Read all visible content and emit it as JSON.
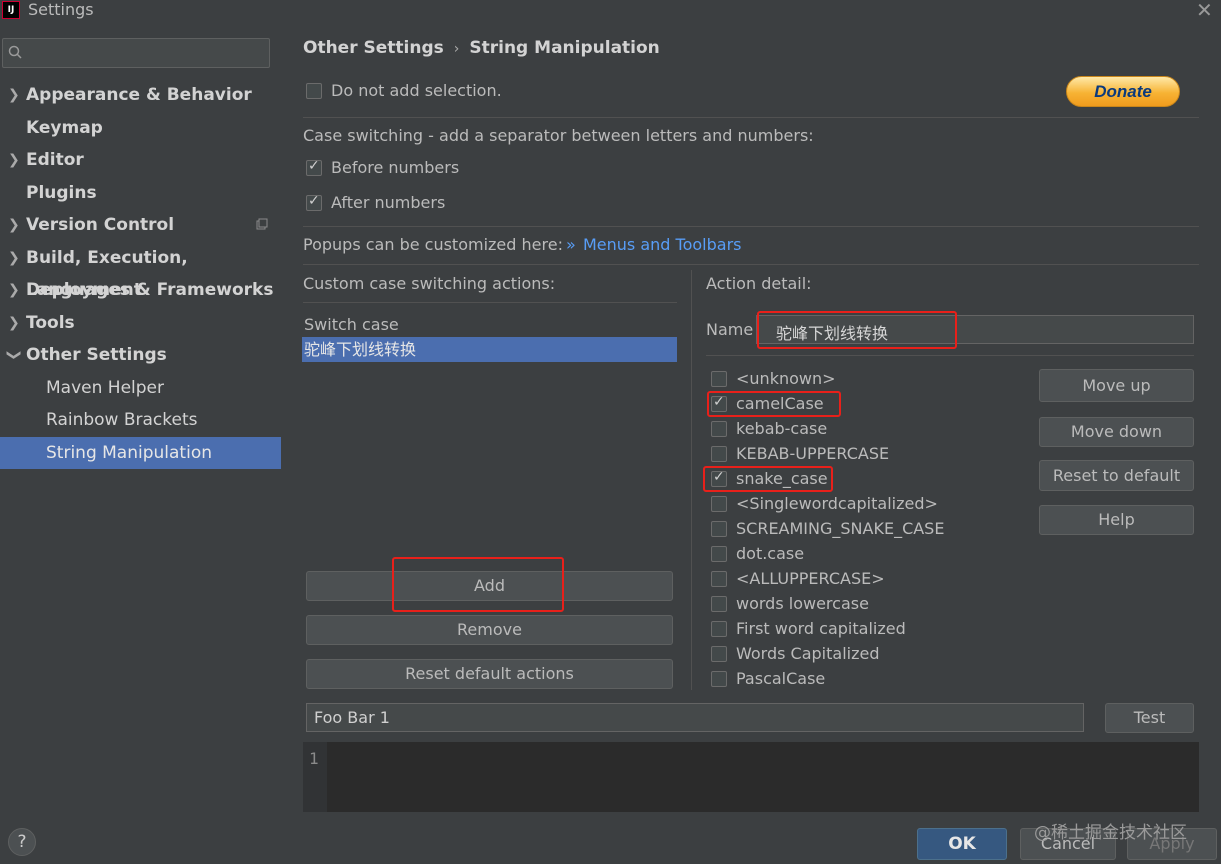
{
  "window": {
    "title": "Settings",
    "app_icon": "IJ"
  },
  "sidebar": {
    "search_placeholder": "",
    "items": [
      {
        "label": "Appearance & Behavior",
        "expandable": true
      },
      {
        "label": "Keymap",
        "expandable": false
      },
      {
        "label": "Editor",
        "expandable": true
      },
      {
        "label": "Plugins",
        "expandable": false
      },
      {
        "label": "Version Control",
        "expandable": true
      },
      {
        "label": "Build, Execution, Deployment",
        "expandable": true
      },
      {
        "label": "Languages & Frameworks",
        "expandable": true
      },
      {
        "label": "Tools",
        "expandable": true
      },
      {
        "label": "Other Settings",
        "expandable": true,
        "expanded": true
      },
      {
        "label": "Maven Helper"
      },
      {
        "label": "Rainbow Brackets"
      },
      {
        "label": "String Manipulation",
        "selected": true
      }
    ]
  },
  "breadcrumb": {
    "parent": "Other Settings",
    "separator": "›",
    "current": "String Manipulation"
  },
  "main": {
    "do_not_add_selection": {
      "label": "Do not add selection.",
      "checked": false
    },
    "donate_label": "Donate",
    "case_switching_label": "Case switching - add a separator between letters and numbers:",
    "before_numbers": {
      "label": "Before numbers",
      "checked": true
    },
    "after_numbers": {
      "label": "After numbers",
      "checked": true
    },
    "popups_label": "Popups can be customized here:",
    "popups_link": "Menus and Toolbars",
    "custom_actions_label": "Custom case switching actions:",
    "custom_actions": [
      "Switch case",
      "驼峰下划线转换"
    ],
    "add_button": "Add",
    "remove_button": "Remove",
    "reset_actions_button": "Reset default actions",
    "action_detail_label": "Action detail:",
    "name_label": "Name",
    "name_value": "驼峰下划线转换",
    "cases": [
      {
        "label": "<unknown>",
        "checked": false
      },
      {
        "label": "camelCase",
        "checked": true
      },
      {
        "label": "kebab-case",
        "checked": false
      },
      {
        "label": "KEBAB-UPPERCASE",
        "checked": false
      },
      {
        "label": "snake_case",
        "checked": true
      },
      {
        "label": "<Singlewordcapitalized>",
        "checked": false
      },
      {
        "label": "SCREAMING_SNAKE_CASE",
        "checked": false
      },
      {
        "label": "dot.case",
        "checked": false
      },
      {
        "label": "<ALLUPPERCASE>",
        "checked": false
      },
      {
        "label": "words lowercase",
        "checked": false
      },
      {
        "label": "First word capitalized",
        "checked": false
      },
      {
        "label": "Words Capitalized",
        "checked": false
      },
      {
        "label": "PascalCase",
        "checked": false
      }
    ],
    "move_up": "Move up",
    "move_down": "Move down",
    "reset_to_default": "Reset to default",
    "help": "Help",
    "test_input_value": "Foo Bar 1",
    "test_button": "Test",
    "editor_line": "1"
  },
  "footer": {
    "help": "?",
    "ok": "OK",
    "cancel": "Cancel",
    "apply": "Apply",
    "watermark": "@稀土掘金技术社区"
  },
  "colors": {
    "selection": "#4b6eaf",
    "highlight_box": "#e8201a",
    "link": "#589df6",
    "background": "#3c3f41"
  }
}
